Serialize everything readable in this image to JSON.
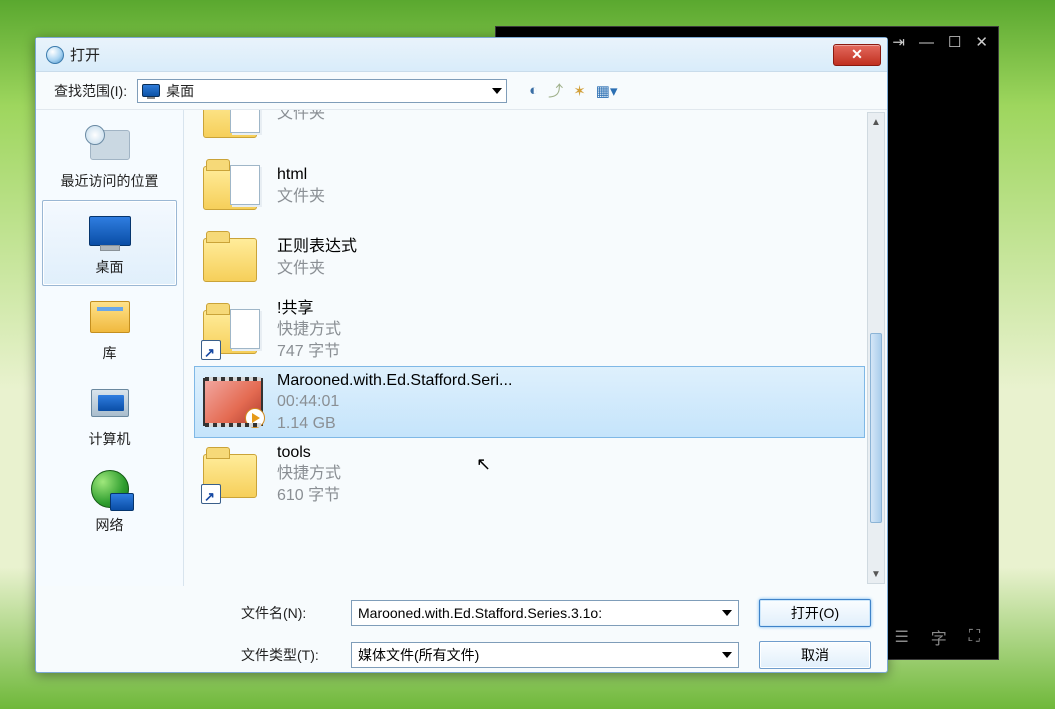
{
  "dialog": {
    "title": "打开",
    "lookin_label": "查找范围(I):",
    "lookin_value": "桌面",
    "filename_label": "文件名(N):",
    "filename_value": "Marooned.with.Ed.Stafford.Series.3.1o:",
    "filetype_label": "文件类型(T):",
    "filetype_value": "媒体文件(所有文件)",
    "open_btn": "打开(O)",
    "cancel_btn": "取消"
  },
  "places": [
    {
      "label": "最近访问的位置",
      "icon": "recent",
      "selected": false
    },
    {
      "label": "桌面",
      "icon": "desktop",
      "selected": true
    },
    {
      "label": "库",
      "icon": "library",
      "selected": false
    },
    {
      "label": "计算机",
      "icon": "computer",
      "selected": false
    },
    {
      "label": "网络",
      "icon": "network",
      "selected": false
    }
  ],
  "files": [
    {
      "name": "",
      "sub1": "文件夹",
      "sub2": "",
      "kind": "folder-doc",
      "shortcut": false,
      "selected": false
    },
    {
      "name": "html",
      "sub1": "文件夹",
      "sub2": "",
      "kind": "folder-doc",
      "shortcut": false,
      "selected": false
    },
    {
      "name": "正则表达式",
      "sub1": "文件夹",
      "sub2": "",
      "kind": "folder",
      "shortcut": false,
      "selected": false
    },
    {
      "name": "!共享",
      "sub1": "快捷方式",
      "sub2": "747 字节",
      "kind": "folder-doc",
      "shortcut": true,
      "selected": false
    },
    {
      "name": "Marooned.with.Ed.Stafford.Seri...",
      "sub1": "00:44:01",
      "sub2": "1.14 GB",
      "kind": "video",
      "shortcut": false,
      "selected": true
    },
    {
      "name": "tools",
      "sub1": "快捷方式",
      "sub2": "610 字节",
      "kind": "folder",
      "shortcut": true,
      "selected": false
    }
  ],
  "bgplayer": {
    "bottom_text": "字"
  }
}
